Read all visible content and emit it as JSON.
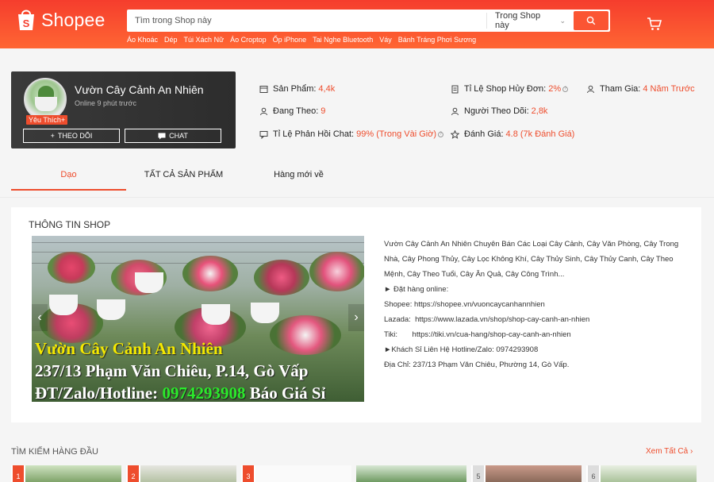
{
  "header": {
    "logo_text": "Shopee",
    "search_placeholder": "Tìm trong Shop này",
    "search_scope": "Trong Shop này",
    "hot_keywords": [
      "Áo Khoác",
      "Dép",
      "Túi Xách Nữ",
      "Áo Croptop",
      "Ốp iPhone",
      "Tai Nghe Bluetooth",
      "Váy",
      "Bánh Tráng Phơi Sương"
    ],
    "brand_color": "#ee4d2d"
  },
  "shop": {
    "name": "Vườn Cây Cảnh An Nhiên",
    "online_status": "Online 9 phút trước",
    "badge": "Yêu Thích+",
    "follow_label": "THEO DÕI",
    "chat_label": "CHAT"
  },
  "stats": {
    "products_label": "Sản Phẩm:",
    "products_value": "4,4k",
    "following_label": "Đang Theo:",
    "following_value": "9",
    "chat_rate_label": "Tỉ Lệ Phản Hồi Chat:",
    "chat_rate_value": "99% (Trong Vài Giờ)",
    "cancel_label": "Tỉ Lệ Shop Hủy Đơn:",
    "cancel_value": "2%",
    "followers_label": "Người Theo Dõi:",
    "followers_value": "2,8k",
    "rating_label": "Đánh Giá:",
    "rating_value": "4.8 (7k Đánh Giá)",
    "joined_label": "Tham Gia:",
    "joined_value": "4 Năm Trước"
  },
  "tabs": [
    "Dạo",
    "TẤT CẢ SẢN PHẨM",
    "Hàng mới về"
  ],
  "shop_info": {
    "title": "THÔNG TIN SHOP",
    "banner_line1": "Vườn Cây Cảnh An Nhiên",
    "banner_line2": "237/13 Phạm Văn Chiêu, P.14, Gò Vấp",
    "banner_line3_prefix": "ĐT/Zalo/Hotline: ",
    "banner_line3_phone": "0974293908",
    "banner_line3_suffix": " Báo Giá Sỉ",
    "description_intro": "Vườn Cây Cảnh An Nhiên Chuyên Bán Các Loại Cây Cảnh, Cây Văn Phòng, Cây Trong Nhà, Cây Phong Thủy, Cây Lọc Không Khí, Cây Thủy Sinh, Cây Thủy Canh, Cây Theo Mệnh, Cây Theo Tuổi, Cây Ăn Quả, Cây Công Trình...",
    "order_online": "► Đặt hàng online:",
    "shopee_link": "Shopee: https://shopee.vn/vuoncaycanhannhien",
    "lazada_link": "Lazada:  https://www.lazada.vn/shop/shop-cay-canh-an-nhien",
    "tiki_link": "Tiki:       https://tiki.vn/cua-hang/shop-cay-canh-an-nhien",
    "wholesale": "►Khách Sỉ Liên Hệ Hotline/Zalo: 0974293908",
    "address": "Địa Chỉ: 237/13 Phạm Văn Chiêu, Phường 14, Gò Vấp."
  },
  "top_search": {
    "title": "TÌM KIẾM HÀNG ĐẦU",
    "see_all": "Xem Tất Cả",
    "ranks": [
      "1",
      "2",
      "3",
      "",
      "5",
      "6"
    ]
  }
}
